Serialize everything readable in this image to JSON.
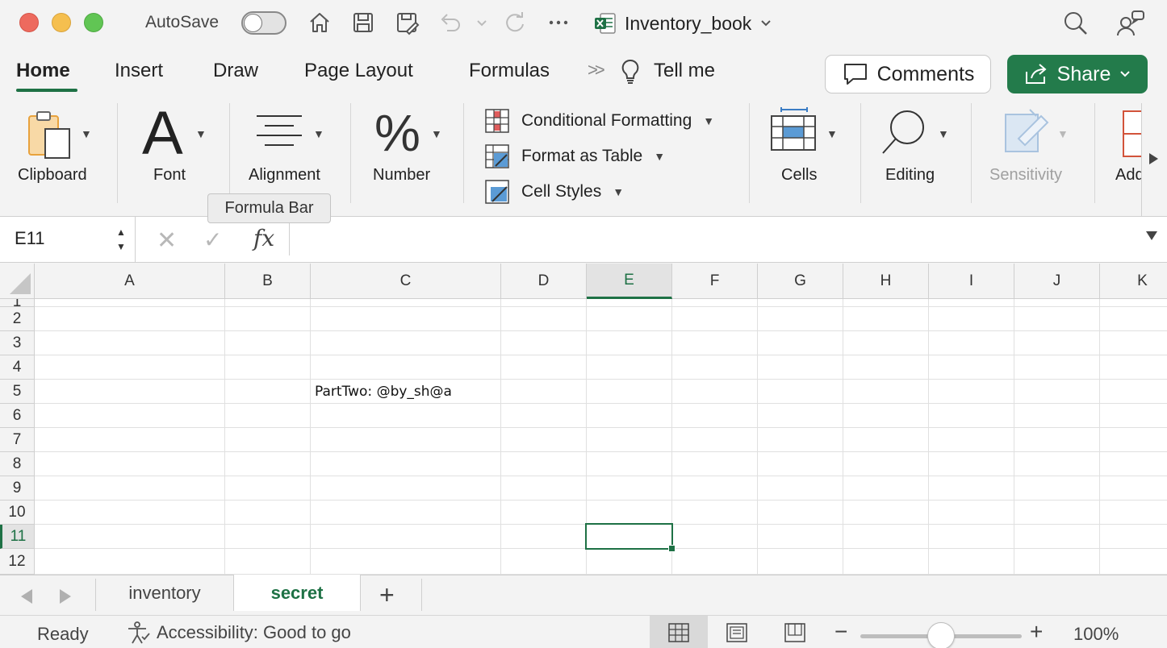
{
  "titlebar": {
    "autosave_label": "AutoSave",
    "autosave_on": false,
    "workbook_name": "Inventory_book",
    "icons": [
      "home-icon",
      "save-icon",
      "save-as-icon",
      "undo-icon",
      "redo-icon",
      "more-icon",
      "search-icon",
      "person-icon"
    ]
  },
  "tabs": {
    "items": [
      "Home",
      "Insert",
      "Draw",
      "Page Layout",
      "Formulas"
    ],
    "active": "Home",
    "tell_me": "Tell me",
    "comments_label": "Comments",
    "share_label": "Share"
  },
  "ribbon": {
    "clipboard": "Clipboard",
    "font": "Font",
    "alignment": "Alignment",
    "number": "Number",
    "conditional_formatting": "Conditional Formatting",
    "format_as_table": "Format as Table",
    "cell_styles": "Cell Styles",
    "cells": "Cells",
    "editing": "Editing",
    "sensitivity": "Sensitivity",
    "addins_partial": "Add"
  },
  "tooltip": "Formula Bar",
  "formula_bar": {
    "name_box": "E11",
    "fx": "fx",
    "content": ""
  },
  "grid": {
    "columns": [
      "A",
      "B",
      "C",
      "D",
      "E",
      "F",
      "G",
      "H",
      "I",
      "J",
      "K"
    ],
    "rows": [
      "1",
      "2",
      "3",
      "4",
      "5",
      "6",
      "7",
      "8",
      "9",
      "10",
      "11",
      "12"
    ],
    "active_column": "E",
    "active_row": "11",
    "cells": {
      "C5": "PartTwo: @by_sh@a"
    }
  },
  "sheets": {
    "items": [
      "inventory",
      "secret"
    ],
    "active": "secret",
    "add_label": "+"
  },
  "status": {
    "ready": "Ready",
    "accessibility": "Accessibility: Good to go",
    "zoom": "100%",
    "zoom_fraction": 0.5
  },
  "colors": {
    "accent": "#1e7145",
    "share_bg": "#237b4b",
    "traffic_red": "#ed6a5e",
    "traffic_yellow": "#f5bf4f",
    "traffic_green": "#61c554"
  }
}
